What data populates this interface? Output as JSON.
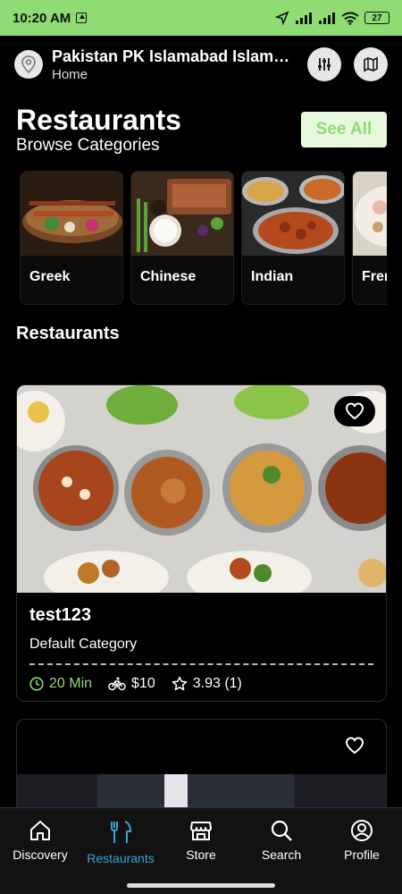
{
  "status": {
    "time": "10:20 AM",
    "battery": "27"
  },
  "header": {
    "location": "Pakistan PK Islamabad Islamabad Capital Territory",
    "subtitle": "Home"
  },
  "section": {
    "title": "Restaurants",
    "subtitle": "Browse Categories",
    "see_all": "See All"
  },
  "categories": [
    {
      "label": "Greek"
    },
    {
      "label": "Chinese"
    },
    {
      "label": "Indian"
    },
    {
      "label": "French"
    }
  ],
  "restaurants_heading": "Restaurants",
  "restaurants": [
    {
      "name": "test123",
      "category": "Default Category",
      "time": "20 Min",
      "delivery_fee": "$10",
      "rating": "3.93 (1)"
    }
  ],
  "nav": [
    {
      "label": "Discovery",
      "icon": "home-icon"
    },
    {
      "label": "Restaurants",
      "icon": "fork-knife-icon"
    },
    {
      "label": "Store",
      "icon": "store-icon"
    },
    {
      "label": "Search",
      "icon": "search-icon"
    },
    {
      "label": "Profile",
      "icon": "profile-icon"
    }
  ],
  "colors": {
    "accent": "#8fdc74",
    "active_nav": "#3aa3d6"
  }
}
